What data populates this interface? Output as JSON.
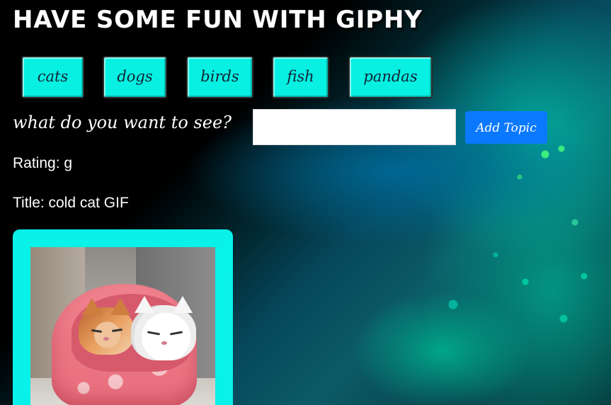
{
  "header": {
    "title": "HAVE SOME FUN WITH GIPHY"
  },
  "topics": [
    {
      "label": "cats"
    },
    {
      "label": "dogs"
    },
    {
      "label": "birds"
    },
    {
      "label": "fish"
    },
    {
      "label": "pandas"
    }
  ],
  "search": {
    "prompt": "what do you want to see?",
    "value": "",
    "add_button_label": "Add Topic"
  },
  "gif": {
    "rating": "Rating: g",
    "title": "Title: cold cat GIF"
  },
  "colors": {
    "topic_button": "#07f0e2",
    "add_button": "#0b79ff",
    "gif_card": "#08f2e9"
  }
}
